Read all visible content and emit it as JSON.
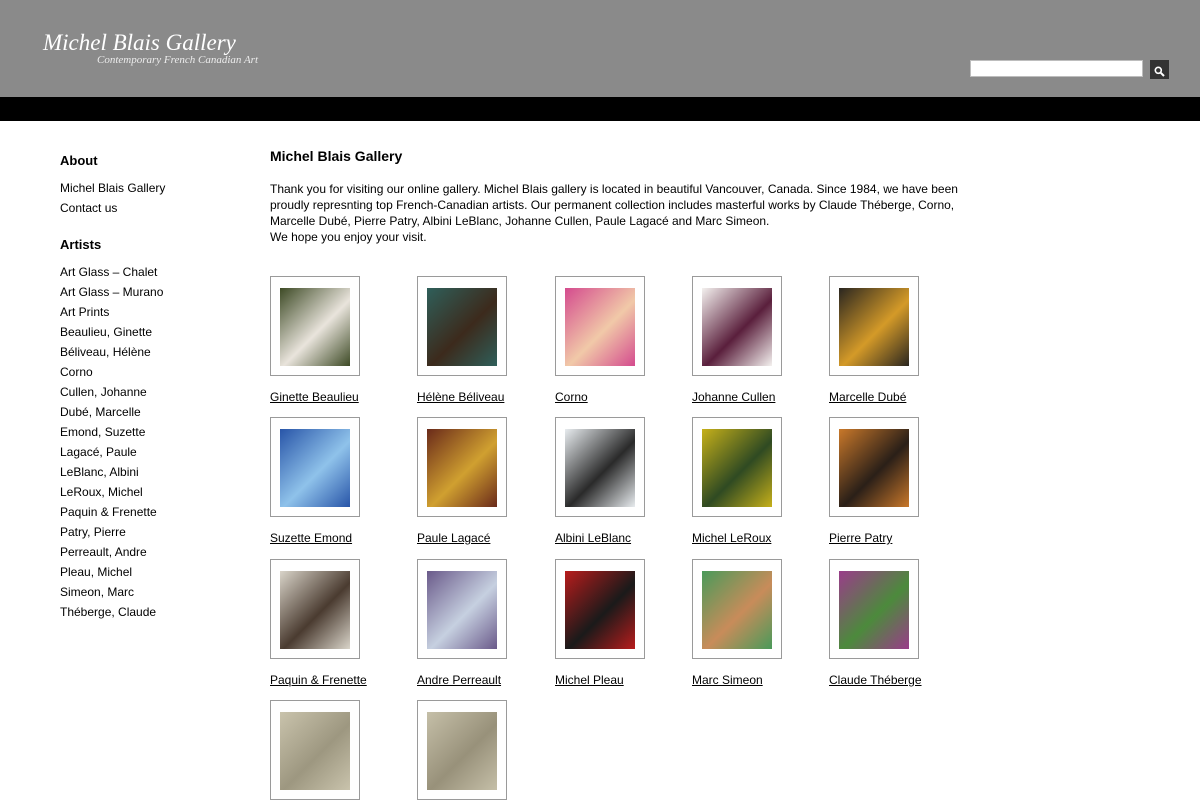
{
  "header": {
    "site_title": "Michel Blais Gallery",
    "tagline": "Contemporary French Canadian Art",
    "search": {
      "value": "",
      "placeholder": ""
    },
    "search_button_icon": "search-icon",
    "colors": {
      "header_bg": "#8a8a8a",
      "bar": "#000000"
    }
  },
  "sidebar": {
    "about_heading": "About",
    "about_items": [
      "Michel Blais Gallery",
      "Contact us"
    ],
    "artists_heading": "Artists",
    "artist_items": [
      "Art Glass – Chalet",
      "Art Glass – Murano",
      "Art Prints",
      "Beaulieu, Ginette",
      "Béliveau, Hélène",
      "Corno",
      "Cullen, Johanne",
      "Dubé, Marcelle",
      "Emond, Suzette",
      "Lagacé, Paule",
      "LeBlanc, Albini",
      "LeRoux, Michel",
      "Paquin & Frenette",
      "Patry, Pierre",
      "Perreault, Andre",
      "Pleau, Michel",
      "Simeon, Marc",
      "Théberge, Claude"
    ]
  },
  "main": {
    "title": "Michel Blais Gallery",
    "intro_lines": [
      "Thank you for visiting our online gallery. Michel Blais gallery is located in beautiful Vancouver, Canada. Since 1984, we have been proudly represnting top French-Canadian artists. Our permanent collection includes masterful works by  Claude Théberge, Corno, Marcelle Dubé, Pierre Patry, Albini LeBlanc, Johanne Cullen, Paule Lagacé and Marc Simeon.",
      "We hope you enjoy your visit."
    ],
    "artists_grid": [
      {
        "name": "Ginette Beaulieu",
        "colors": [
          "#3d4a25",
          "#e9e4dc"
        ]
      },
      {
        "name": "Hélène Béliveau",
        "colors": [
          "#2f5f5a",
          "#3c2a1c"
        ]
      },
      {
        "name": "Corno",
        "colors": [
          "#d44b8e",
          "#f1c9a8"
        ]
      },
      {
        "name": "Johanne Cullen",
        "colors": [
          "#f4f1ef",
          "#5a1f3c"
        ]
      },
      {
        "name": "Marcelle Dubé",
        "colors": [
          "#2a2620",
          "#d49a28"
        ]
      },
      {
        "name": "Suzette Emond",
        "colors": [
          "#2855a8",
          "#8fc2ea"
        ]
      },
      {
        "name": "Paule Lagacé",
        "colors": [
          "#6a2a1a",
          "#d0a030"
        ]
      },
      {
        "name": "Albini LeBlanc",
        "colors": [
          "#e8ecef",
          "#2a2a2a"
        ]
      },
      {
        "name": "Michel LeRoux",
        "colors": [
          "#c6b01a",
          "#2f4a22"
        ]
      },
      {
        "name": "Pierre Patry",
        "colors": [
          "#c9782a",
          "#2a1f18"
        ]
      },
      {
        "name": "Paquin & Frenette",
        "colors": [
          "#d9d4c9",
          "#4a3b30"
        ]
      },
      {
        "name": "Andre Perreault",
        "colors": [
          "#6a5a8a",
          "#c6d0e0"
        ]
      },
      {
        "name": "Michel Pleau",
        "colors": [
          "#b81c1c",
          "#1a1a1a"
        ]
      },
      {
        "name": "Marc Simeon",
        "colors": [
          "#4a9a5a",
          "#c88c5a"
        ]
      },
      {
        "name": "Claude Théberge",
        "colors": [
          "#9a3c8a",
          "#4c8a3c"
        ]
      },
      {
        "name": "",
        "colors": [
          "#c9c3ac",
          "#9d9780"
        ]
      },
      {
        "name": "",
        "colors": [
          "#c5bfa8",
          "#98917a"
        ]
      }
    ]
  }
}
